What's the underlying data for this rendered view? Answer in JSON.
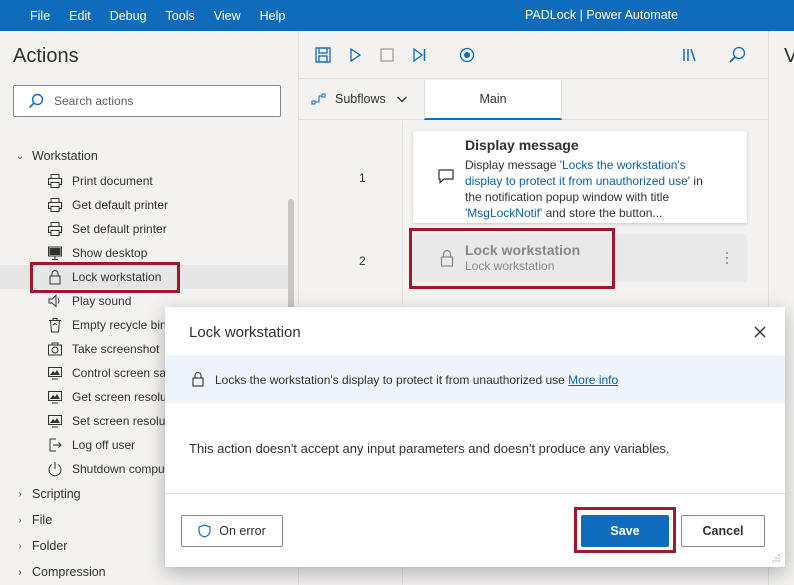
{
  "window": {
    "menu": [
      "File",
      "Edit",
      "Debug",
      "Tools",
      "View",
      "Help"
    ],
    "title": "PADLock | Power Automate"
  },
  "actions_pane": {
    "title": "Actions",
    "search_placeholder": "Search actions",
    "groups": [
      {
        "label": "Workstation",
        "expanded": true
      },
      {
        "label": "Scripting",
        "expanded": false
      },
      {
        "label": "File",
        "expanded": false
      },
      {
        "label": "Folder",
        "expanded": false
      },
      {
        "label": "Compression",
        "expanded": false
      }
    ],
    "workstation_items": [
      {
        "label": "Print document",
        "icon": "printer-icon"
      },
      {
        "label": "Get default printer",
        "icon": "printer-icon"
      },
      {
        "label": "Set default printer",
        "icon": "printer-icon"
      },
      {
        "label": "Show desktop",
        "icon": "monitor-icon"
      },
      {
        "label": "Lock workstation",
        "icon": "lock-icon",
        "selected": true
      },
      {
        "label": "Play sound",
        "icon": "speaker-icon"
      },
      {
        "label": "Empty recycle bin",
        "icon": "recycle-bin-icon"
      },
      {
        "label": "Take screenshot",
        "icon": "camera-icon"
      },
      {
        "label": "Control screen saver",
        "icon": "screen-icon"
      },
      {
        "label": "Get screen resolution",
        "icon": "screen-icon"
      },
      {
        "label": "Set screen resolution",
        "icon": "screen-icon"
      },
      {
        "label": "Log off user",
        "icon": "logoff-icon"
      },
      {
        "label": "Shutdown computer",
        "icon": "power-icon"
      }
    ]
  },
  "designer": {
    "subflows_label": "Subflows",
    "main_tab": "Main",
    "steps": [
      {
        "number": "1",
        "title": "Display message",
        "desc_prefix": "Display message ",
        "desc_link1": "'Locks the workstation's display to protect it from unauthorized use'",
        "desc_mid": " in the notification popup window with title ",
        "desc_link2": "'MsgLockNotif'",
        "desc_suffix": " and store the button...",
        "icon": "message-icon"
      },
      {
        "number": "2",
        "title": "Lock workstation",
        "description": "Lock workstation",
        "icon": "lock-icon",
        "disabled": true
      }
    ]
  },
  "right_pane": {
    "letter": "V"
  },
  "dialog": {
    "title": "Lock workstation",
    "info_text": "Locks the workstation's display to protect it from unauthorized use",
    "info_link": "More info",
    "body": "This action doesn't accept any input parameters and doesn't produce any variables.",
    "on_error_label": "On error",
    "save_label": "Save",
    "cancel_label": "Cancel"
  },
  "colors": {
    "accent": "#0f6cbd",
    "highlight": "#a0182d",
    "link": "#0f5fa8"
  }
}
